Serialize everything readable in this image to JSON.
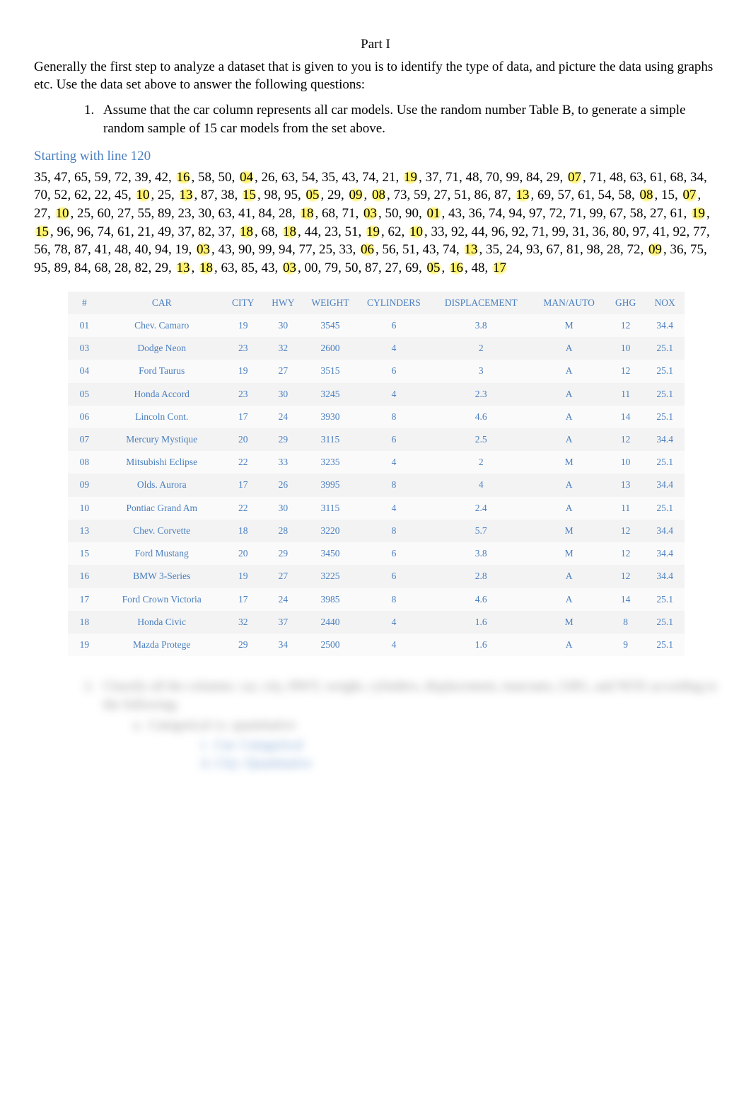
{
  "part_title": "Part I",
  "intro": "Generally the first step to analyze a dataset that is given to you is to identify the type of data, and picture the data using graphs etc. Use the data set above to answer the following questions:",
  "q1": "Assume that the car  column represents all car models. Use the random number Table B, to generate a simple random sample of 15 car models from the set above.",
  "starting_line": "Starting with line 120",
  "numbers_html": "35, 47, 65, 59, 72, 39, 42, <span class='hl'>16</span>, 58, 50, <span class='hl'>04</span>, 26, 63, 54, 35, 43, 74, 21, <span class='hl'>19</span>, 37, 71, 48, 70, 99, 84, 29, <span class='hl'>07</span>, 71, 48, 63, 61, 68, 34, 70, 52, 62, 22, 45, <span class='hl'>10</span>, 25, <span class='hl'>13</span>, 87, 38, <span class='hl'>15</span>, 98, 95, <span class='hl'>05</span>, 29, <span class='hl'>09</span>, <span class='hl'>08</span>, 73, 59, 27, 51, 86, 87, <span class='hl'>13</span>, 69, 57, 61, 54, 58, <span class='hl'>08</span>, 15, <span class='hl'>07</span>, 27, <span class='hl'>10</span>, 25, 60, 27, 55, 89, 23, 30, 63, 41, 84, 28, <span class='hl'>18</span>, 68, 71, <span class='hl'>03</span>, 50, 90, <span class='hl'>01</span>, 43, 36, 74, 94, 97, 72, 71, 99, 67, 58, 27, 61, <span class='hl'>19</span>, <span class='hl'>15</span>, 96, 96, 74, 61, 21, 49, 37, 82, 37, <span class='hl'>18</span>, 68, <span class='hl'>18</span>, 44, 23, 51, <span class='hl'>19</span>, 62, <span class='hl'>10</span>, 33, 92, 44, 96, 92, 71, 99, 31, 36, 80, 97, 41, 92, 77, 56, 78, 87, 41, 48, 40, 94, 19, <span class='hl'>03</span>, 43, 90, 99, 94, 77, 25, 33, <span class='hl'>06</span>, 56, 51, 43, 74, <span class='hl'>13</span>, 35, 24, 93, 67, 81, 98, 28, 72, <span class='hl'>09</span>, 36, 75, 95, 89, 84, 68, 28, 82, 29, <span class='hl'>13</span>, <span class='hl'>18</span>, 63, 85, 43, <span class='hl'>03</span>, 00, 79, 50, 87, 27, 69, <span class='hl'>05</span>, <span class='hl'>16</span>, 48, <span class='hl'>17</span>",
  "table": {
    "headers": [
      "#",
      "CAR",
      "CITY",
      "HWY",
      "WEIGHT",
      "CYLINDERS",
      "DISPLACEMENT",
      "MAN/AUTO",
      "GHG",
      "NOX"
    ],
    "rows": [
      {
        "num": "01",
        "car": "Chev. Camaro",
        "city": "19",
        "hwy": "30",
        "wt": "3545",
        "cyl": "6",
        "disp": "3.8",
        "ma": "M",
        "ghg": "12",
        "nox": "34.4"
      },
      {
        "num": "03",
        "car": "Dodge Neon",
        "city": "23",
        "hwy": "32",
        "wt": "2600",
        "cyl": "4",
        "disp": "2",
        "ma": "A",
        "ghg": "10",
        "nox": "25.1"
      },
      {
        "num": "04",
        "car": "Ford Taurus",
        "city": "19",
        "hwy": "27",
        "wt": "3515",
        "cyl": "6",
        "disp": "3",
        "ma": "A",
        "ghg": "12",
        "nox": "25.1"
      },
      {
        "num": "05",
        "car": "Honda Accord",
        "city": "23",
        "hwy": "30",
        "wt": "3245",
        "cyl": "4",
        "disp": "2.3",
        "ma": "A",
        "ghg": "11",
        "nox": "25.1"
      },
      {
        "num": "06",
        "car": "Lincoln Cont.",
        "city": "17",
        "hwy": "24",
        "wt": "3930",
        "cyl": "8",
        "disp": "4.6",
        "ma": "A",
        "ghg": "14",
        "nox": "25.1"
      },
      {
        "num": "07",
        "car": "Mercury Mystique",
        "city": "20",
        "hwy": "29",
        "wt": "3115",
        "cyl": "6",
        "disp": "2.5",
        "ma": "A",
        "ghg": "12",
        "nox": "34.4"
      },
      {
        "num": "08",
        "car": "Mitsubishi Eclipse",
        "city": "22",
        "hwy": "33",
        "wt": "3235",
        "cyl": "4",
        "disp": "2",
        "ma": "M",
        "ghg": "10",
        "nox": "25.1"
      },
      {
        "num": "09",
        "car": "Olds. Aurora",
        "city": "17",
        "hwy": "26",
        "wt": "3995",
        "cyl": "8",
        "disp": "4",
        "ma": "A",
        "ghg": "13",
        "nox": "34.4"
      },
      {
        "num": "10",
        "car": "Pontiac Grand Am",
        "city": "22",
        "hwy": "30",
        "wt": "3115",
        "cyl": "4",
        "disp": "2.4",
        "ma": "A",
        "ghg": "11",
        "nox": "25.1"
      },
      {
        "num": "13",
        "car": "Chev. Corvette",
        "city": "18",
        "hwy": "28",
        "wt": "3220",
        "cyl": "8",
        "disp": "5.7",
        "ma": "M",
        "ghg": "12",
        "nox": "34.4"
      },
      {
        "num": "15",
        "car": "Ford Mustang",
        "city": "20",
        "hwy": "29",
        "wt": "3450",
        "cyl": "6",
        "disp": "3.8",
        "ma": "M",
        "ghg": "12",
        "nox": "34.4"
      },
      {
        "num": "16",
        "car": "BMW 3-Series",
        "city": "19",
        "hwy": "27",
        "wt": "3225",
        "cyl": "6",
        "disp": "2.8",
        "ma": "A",
        "ghg": "12",
        "nox": "34.4"
      },
      {
        "num": "17",
        "car": "Ford Crown Victoria",
        "city": "17",
        "hwy": "24",
        "wt": "3985",
        "cyl": "8",
        "disp": "4.6",
        "ma": "A",
        "ghg": "14",
        "nox": "25.1"
      },
      {
        "num": "18",
        "car": "Honda Civic",
        "city": "32",
        "hwy": "37",
        "wt": "2440",
        "cyl": "4",
        "disp": "1.6",
        "ma": "M",
        "ghg": "8",
        "nox": "25.1"
      },
      {
        "num": "19",
        "car": "Mazda Protege",
        "city": "29",
        "hwy": "34",
        "wt": "2500",
        "cyl": "4",
        "disp": "1.6",
        "ma": "A",
        "ghg": "9",
        "nox": "25.1"
      }
    ]
  },
  "q2": "Classify all the columns: car, city, HWY, weight, cylinders, displacement, man/auto, GHG, and NOX according to the following:",
  "q2a": "Categorical vs. quantitative",
  "q2a_i": "Car: Categorical",
  "q2a_ii": "City: Quantitative"
}
